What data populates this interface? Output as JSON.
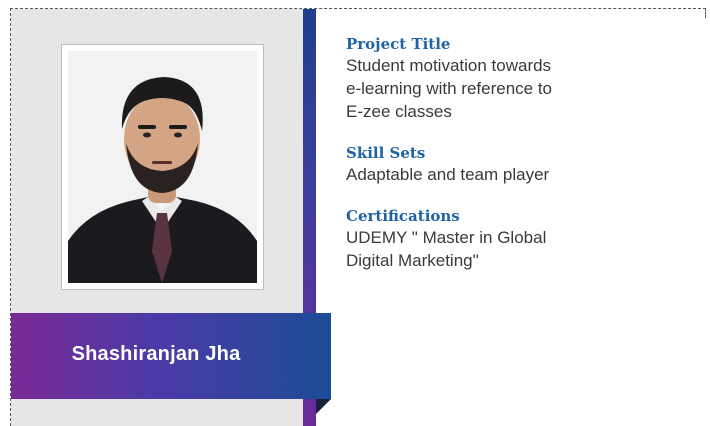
{
  "profile": {
    "name": "Shashiranjan Jha"
  },
  "sections": [
    {
      "heading": "Project Title",
      "lines": [
        "Student motivation towards",
        "e-learning with reference to",
        "E-zee classes"
      ]
    },
    {
      "heading": "Skill Sets",
      "lines": [
        "Adaptable and team player"
      ]
    },
    {
      "heading": "Certifications",
      "lines": [
        "UDEMY \" Master in Global",
        "Digital Marketing\""
      ]
    }
  ],
  "colors": {
    "heading": "#1f63a6",
    "ribbon_start": "#7a2a96",
    "ribbon_end": "#1c4c97",
    "panel": "#e6e6e6"
  },
  "icons": [
    "portrait-photo"
  ]
}
